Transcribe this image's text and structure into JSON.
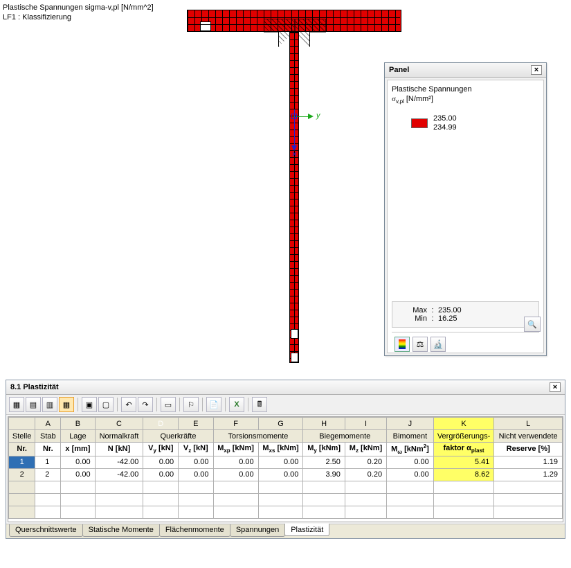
{
  "header": {
    "line1": "Plastische Spannungen sigma-v,pl [N/mm^2]",
    "line2": "LF1 : Klassifizierung"
  },
  "axes": {
    "y_label": "y"
  },
  "panel": {
    "title": "Panel",
    "sub_line1": "Plastische Spannungen",
    "sub_line2_prefix": "σ",
    "sub_line2_sub": "v,pl",
    "sub_line2_suffix": " [N/mm²]",
    "legend": {
      "value_top": "235.00",
      "value_bottom": "234.99"
    },
    "stats": {
      "max_label": "Max",
      "max_value": "235.00",
      "min_label": "Min",
      "min_value": "16.25"
    }
  },
  "results": {
    "title": "8.1 Plastizität",
    "cols_top": [
      "",
      "A",
      "B",
      "C",
      "D",
      "E",
      "F",
      "G",
      "H",
      "I",
      "J",
      "K",
      "L"
    ],
    "group_headers": {
      "stelle": "Stelle",
      "stab": "Stab",
      "lage": "Lage",
      "normalkraft": "Normalkraft",
      "querkraefte": "Querkräfte",
      "torsionsmomente": "Torsionsmomente",
      "biegemomente": "Biegemomente",
      "bimoment": "Bimoment",
      "vergroesserungs": "Vergrößerungs-",
      "nicht_verwendete": "Nicht verwendete"
    },
    "unit_headers": {
      "nr": "Nr.",
      "stab_nr": "Nr.",
      "x": "x [mm]",
      "N": "N [kN]",
      "Vy": "Vy [kN]",
      "Vz": "Vz [kN]",
      "Mxp": "Mxp [kNm]",
      "Mxs": "Mxs [kNm]",
      "My": "My [kNm]",
      "Mz": "Mz [kNm]",
      "Mw": "Mω [kNm²]",
      "faktor": "faktor αplast",
      "reserve": "Reserve [%]"
    },
    "rows": [
      {
        "nr": "1",
        "stab": "1",
        "x": "0.00",
        "N": "-42.00",
        "Vy": "0.00",
        "Vz": "0.00",
        "Mxp": "0.00",
        "Mxs": "0.00",
        "My": "2.50",
        "Mz": "0.20",
        "Mw": "0.00",
        "alpha": "5.41",
        "res": "1.19"
      },
      {
        "nr": "2",
        "stab": "2",
        "x": "0.00",
        "N": "-42.00",
        "Vy": "0.00",
        "Vz": "0.00",
        "Mxp": "0.00",
        "Mxs": "0.00",
        "My": "3.90",
        "Mz": "0.20",
        "Mw": "0.00",
        "alpha": "8.62",
        "res": "1.29"
      }
    ],
    "tabs": [
      "Querschnittswerte",
      "Statische Momente",
      "Flächenmomente",
      "Spannungen",
      "Plastizität"
    ],
    "active_tab": 4
  }
}
